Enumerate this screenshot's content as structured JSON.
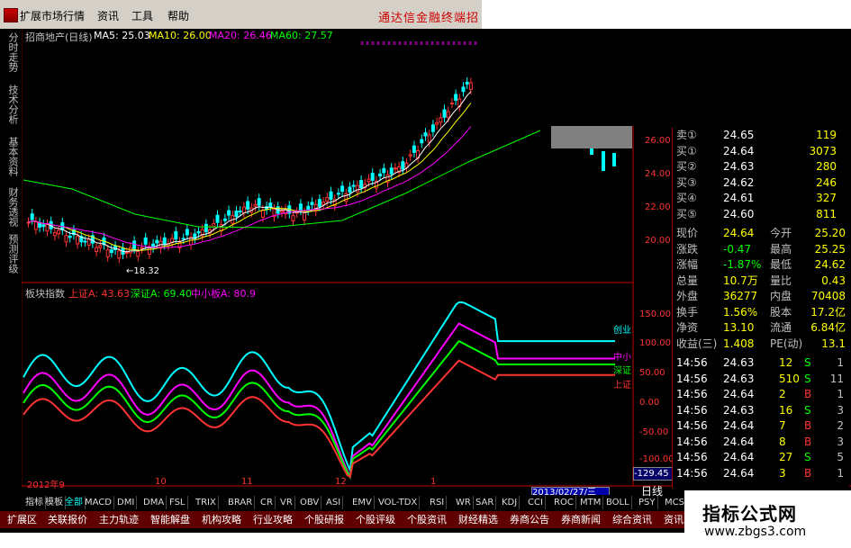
{
  "menubar": {
    "items": [
      "扩展市场行情",
      "资讯",
      "工具",
      "帮助"
    ],
    "brand": "通达信金融终端",
    "brand_tail": "招"
  },
  "left_tabs": [
    "分时走势",
    "技术分析",
    "基本资料",
    "财务透视",
    "预测评级"
  ],
  "kline": {
    "title": "招商地产(日线)",
    "ma": [
      {
        "label": "MA5: 25.03",
        "color": "#ffffff"
      },
      {
        "label": "MA10: 26.00",
        "color": "#ffff00"
      },
      {
        "label": "MA20: 26.46",
        "color": "#ff00ff"
      },
      {
        "label": "MA60: 27.57",
        "color": "#00ff00"
      }
    ],
    "low_marker": "←18.32",
    "y_labels": [
      "26.00",
      "24.00",
      "22.00",
      "20.00"
    ]
  },
  "index_panel": {
    "title": "板块指数",
    "items": [
      {
        "label": "上证A: 43.63",
        "color": "#ff3333"
      },
      {
        "label": "深证A: 69.40",
        "color": "#00ff00"
      },
      {
        "label": "中小板A: 80.9",
        "color": "#ff00ff"
      }
    ],
    "end_labels": [
      {
        "label": "创业",
        "color": "#00ffff"
      },
      {
        "label": "中小",
        "color": "#ff00ff"
      },
      {
        "label": "深证",
        "color": "#00ff00"
      },
      {
        "label": "上证",
        "color": "#ff3333"
      }
    ],
    "y_labels": [
      "150.00",
      "100.00",
      "50.00",
      "0.00",
      "-50.00",
      "-100.00"
    ],
    "neg_value": "-129.45",
    "x_labels": [
      "2012年9",
      "10",
      "11",
      "12",
      "1"
    ],
    "date": "2013/02/27/三"
  },
  "quote": {
    "book": [
      {
        "label": "卖①",
        "price": "24.65",
        "vol": "119"
      },
      {
        "label": "买①",
        "price": "24.64",
        "vol": "3073"
      },
      {
        "label": "买②",
        "price": "24.63",
        "vol": "280"
      },
      {
        "label": "买③",
        "price": "24.62",
        "vol": "246"
      },
      {
        "label": "买④",
        "price": "24.61",
        "vol": "327"
      },
      {
        "label": "买⑤",
        "price": "24.60",
        "vol": "811"
      }
    ],
    "stats": [
      {
        "l1": "现价",
        "v1": "24.64",
        "l2": "今开",
        "v2": "25.20"
      },
      {
        "l1": "涨跌",
        "v1": "-0.47",
        "l2": "最高",
        "v2": "25.25"
      },
      {
        "l1": "涨幅",
        "v1": "-1.87%",
        "l2": "最低",
        "v2": "24.62"
      },
      {
        "l1": "总量",
        "v1": "10.7万",
        "l2": "量比",
        "v2": "0.43"
      },
      {
        "l1": "外盘",
        "v1": "36277",
        "l2": "内盘",
        "v2": "70408"
      },
      {
        "l1": "换手",
        "v1": "1.56%",
        "l2": "股本",
        "v2": "17.2亿"
      },
      {
        "l1": "净资",
        "v1": "13.10",
        "l2": "流通",
        "v2": "6.84亿"
      },
      {
        "l1": "收益(三)",
        "v1": "1.408",
        "l2": "PE(动)",
        "v2": "13.1"
      }
    ],
    "ticks": [
      {
        "time": "14:56",
        "price": "24.63",
        "vol": "12",
        "side": "S",
        "n": "1"
      },
      {
        "time": "14:56",
        "price": "24.63",
        "vol": "510",
        "side": "S",
        "n": "11"
      },
      {
        "time": "14:56",
        "price": "24.64",
        "vol": "2",
        "side": "B",
        "n": "1"
      },
      {
        "time": "14:56",
        "price": "24.63",
        "vol": "16",
        "side": "S",
        "n": "3"
      },
      {
        "time": "14:56",
        "price": "24.64",
        "vol": "7",
        "side": "B",
        "n": "2"
      },
      {
        "time": "14:56",
        "price": "24.64",
        "vol": "8",
        "side": "B",
        "n": "3"
      },
      {
        "time": "14:56",
        "price": "24.64",
        "vol": "27",
        "side": "S",
        "n": "5"
      },
      {
        "time": "14:56",
        "price": "24.64",
        "vol": "3",
        "side": "B",
        "n": "1"
      }
    ]
  },
  "tool_buttons": [
    "指标",
    "模板",
    "全部",
    "MACD",
    "DMI",
    "DMA",
    "FSL",
    "TRIX",
    "BRAR",
    "CR",
    "VR",
    "OBV",
    "ASI",
    "EMV",
    "VOL-TDX",
    "RSI",
    "WR",
    "SAR",
    "KDJ",
    "CCI",
    "ROC",
    "MTM",
    "BOLL",
    "PSY",
    "MCST"
  ],
  "period": "日线",
  "bottom_tabs": [
    "扩展区",
    "关联报价",
    "主力轨迹",
    "智能解盘",
    "机构攻略",
    "行业攻略",
    "个股研报",
    "个股评级",
    "个股资讯",
    "财经精选",
    "券商公告",
    "券商新闻",
    "综合资讯",
    "资讯工场"
  ],
  "watermark": {
    "title": "指标公式网",
    "url": "www.zbgs3.com"
  },
  "colors": {
    "up": "#ff3333",
    "down": "#00ffff",
    "bg": "#000000",
    "axis": "#c00000",
    "bottom": "#600000"
  }
}
